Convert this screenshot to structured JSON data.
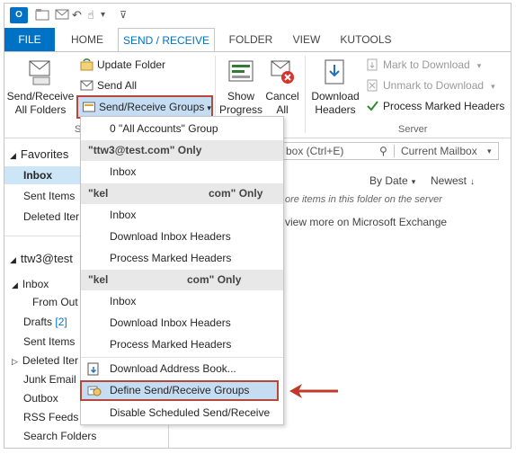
{
  "title_bar": {
    "app_icon": "O",
    "undo": "↶",
    "redo": "↷",
    "touch": "☝",
    "dropdown": "▾",
    "customize": "⊽"
  },
  "tabs": [
    {
      "label": "FILE"
    },
    {
      "label": "HOME"
    },
    {
      "label": "SEND / RECEIVE"
    },
    {
      "label": "FOLDER"
    },
    {
      "label": "VIEW"
    },
    {
      "label": "KUTOOLS"
    }
  ],
  "ribbon": {
    "send_receive_all": [
      "Send/Receive",
      "All Folders"
    ],
    "update_folder": "Update Folder",
    "send_all": "Send All",
    "send_receive_groups": "Send/Receive Groups",
    "group_label_s": "S",
    "show_progress": [
      "Show",
      "Progress"
    ],
    "cancel_all": [
      "Cancel",
      "All"
    ],
    "download_headers": [
      "Download",
      "Headers"
    ],
    "mark_to_download": "Mark to Download",
    "unmark_to_download": "Unmark to Download",
    "process_marked_headers": "Process Marked Headers",
    "server_group_label": "Server"
  },
  "nav": {
    "favorites": "Favorites",
    "favorites_items": [
      "Inbox",
      "Sent Items",
      "Deleted Iter"
    ],
    "account": "ttw3@test",
    "inbox": "Inbox",
    "from_out": "From Out",
    "drafts": "Drafts",
    "drafts_count": "[2]",
    "sent_items": "Sent Items",
    "deleted_items": "Deleted Iter",
    "junk_email": "Junk Email",
    "outbox": "Outbox",
    "rss_feeds": "RSS Feeds",
    "search_folders": "Search Folders"
  },
  "main": {
    "search_placeholder": "box (Ctrl+E)",
    "search_scope": "Current Mailbox",
    "sort_by_date": "By Date",
    "newest": "Newest",
    "more_items_text": "ore items in this folder on the server",
    "view_more_link": "view more on Microsoft Exchange"
  },
  "dropdown": {
    "all_accounts_group": "0 \"All Accounts\" Group",
    "section1_header": "\"ttw3@test.com\" Only",
    "section1_items": [
      "Inbox"
    ],
    "section2_header_left": "\"kel",
    "section2_header_right": "com\" Only",
    "section2_items": [
      "Inbox",
      "Download Inbox Headers",
      "Process Marked Headers"
    ],
    "section3_header_left": "\"kel",
    "section3_header_right": "com\" Only",
    "section3_items": [
      "Inbox",
      "Download Inbox Headers",
      "Process Marked Headers"
    ],
    "download_address_book": "Download Address Book...",
    "define_groups": "Define Send/Receive Groups",
    "disable_scheduled": "Disable Scheduled Send/Receive"
  },
  "colors": {
    "accent": "#0072c6",
    "highlight_border": "#b5473b",
    "highlight_fill": "#c5ddf2"
  }
}
